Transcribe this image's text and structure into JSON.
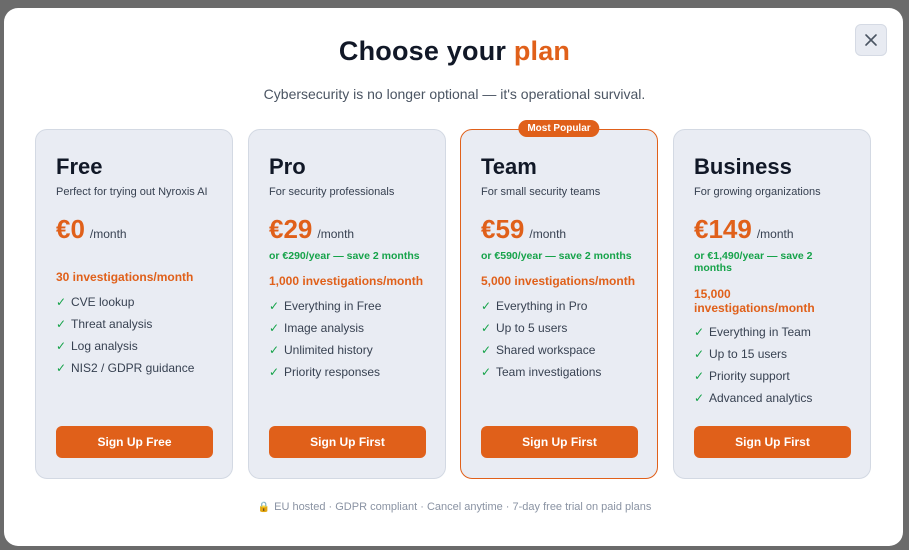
{
  "modal": {
    "title_prefix": "Choose your",
    "title_accent": "plan",
    "subtitle": "Cybersecurity is no longer optional — it's operational survival."
  },
  "plans": [
    {
      "name": "Free",
      "description": "Perfect for trying out Nyroxis AI",
      "price": "€0",
      "period": "/month",
      "annual": "",
      "quota": "30 investigations/month",
      "features": [
        "CVE lookup",
        "Threat analysis",
        "Log analysis",
        "NIS2 / GDPR guidance"
      ],
      "cta": "Sign Up Free"
    },
    {
      "name": "Pro",
      "description": "For security professionals",
      "price": "€29",
      "period": "/month",
      "annual": "or €290/year — save 2 months",
      "quota": "1,000 investigations/month",
      "features": [
        "Everything in Free",
        "Image analysis",
        "Unlimited history",
        "Priority responses"
      ],
      "cta": "Sign Up First"
    },
    {
      "name": "Team",
      "badge": "Most Popular",
      "description": "For small security teams",
      "price": "€59",
      "period": "/month",
      "annual": "or €590/year — save 2 months",
      "quota": "5,000 investigations/month",
      "features": [
        "Everything in Pro",
        "Up to 5 users",
        "Shared workspace",
        "Team investigations"
      ],
      "cta": "Sign Up First"
    },
    {
      "name": "Business",
      "description": "For growing organizations",
      "price": "€149",
      "period": "/month",
      "annual": "or €1,490/year — save 2 months",
      "quota": "15,000 investigations/month",
      "features": [
        "Everything in Team",
        "Up to 15 users",
        "Priority support",
        "Advanced analytics"
      ],
      "cta": "Sign Up First"
    }
  ],
  "footer": {
    "icon": "lock-icon",
    "text": "EU hosted · GDPR compliant · Cancel anytime · 7-day free trial on paid plans"
  },
  "colors": {
    "accent": "#e0601a",
    "success": "#16a34a",
    "card_bg": "#e9ecf3"
  }
}
